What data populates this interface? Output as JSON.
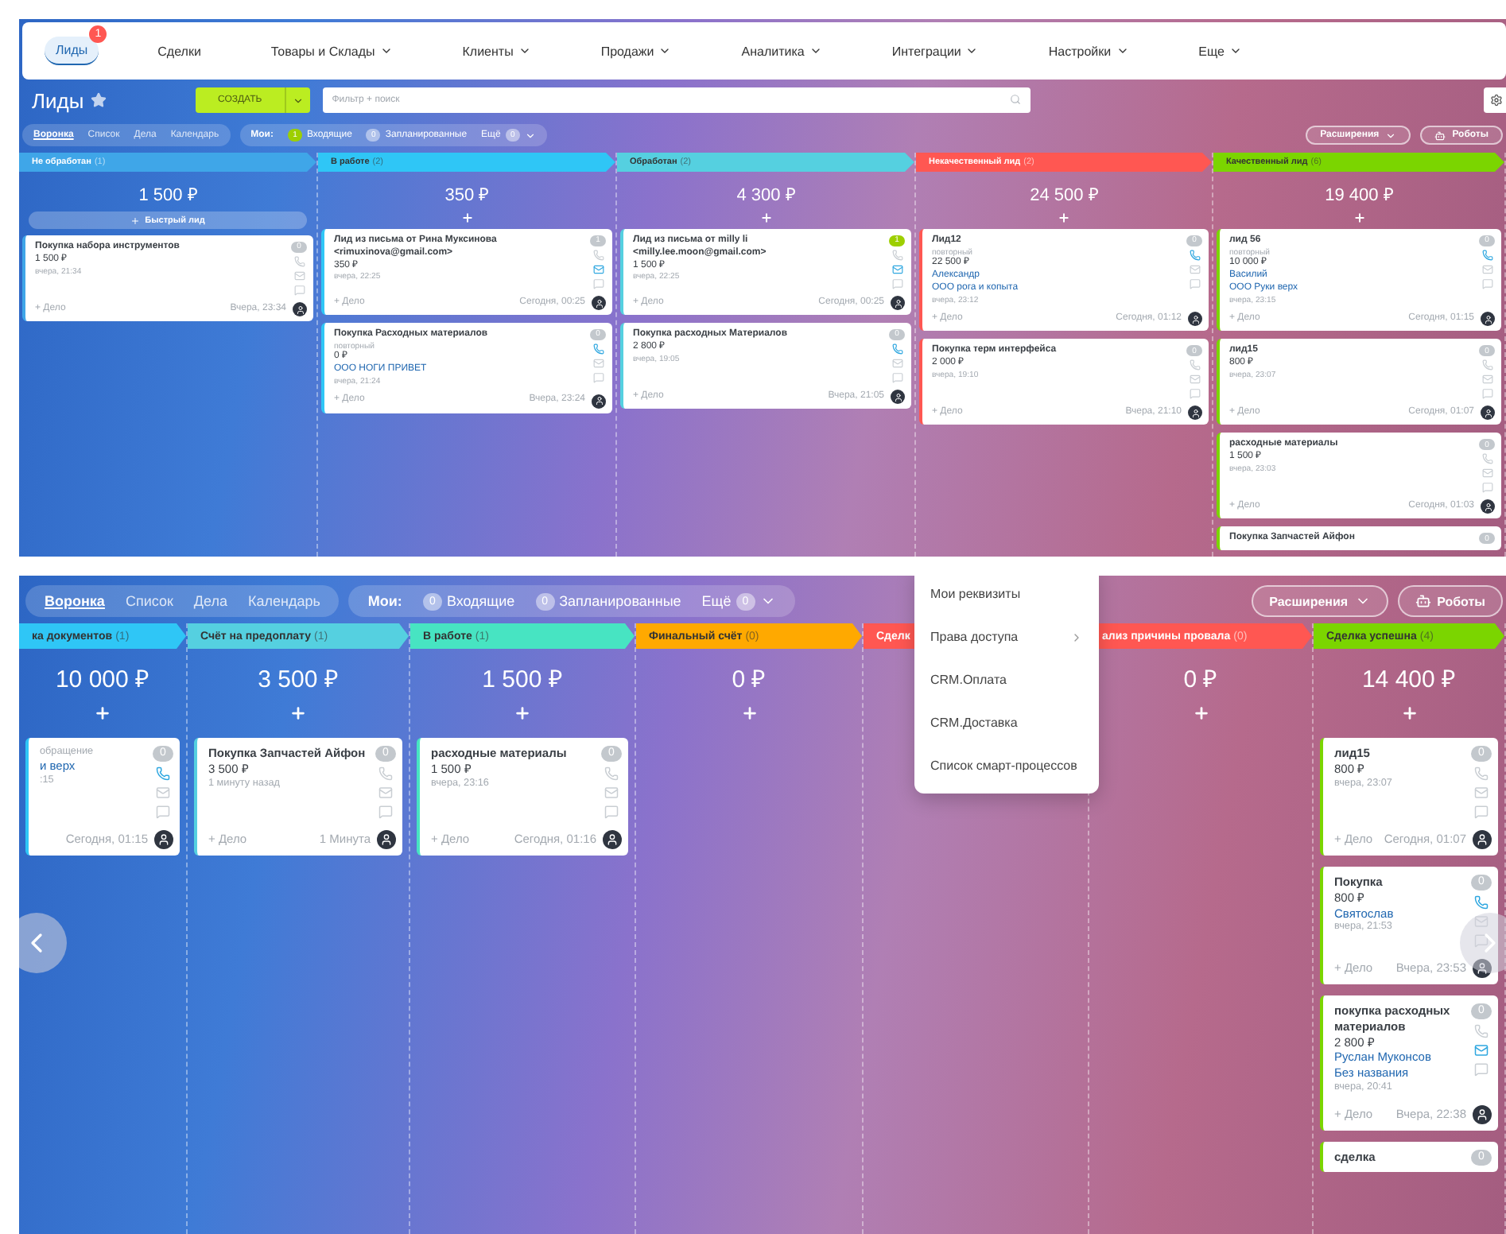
{
  "top": {
    "nav": [
      {
        "label": "Лиды",
        "selected": true,
        "dropdown": false,
        "badge": "1"
      },
      {
        "label": "Сделки",
        "selected": false,
        "dropdown": false
      },
      {
        "label": "Товары и Склады",
        "selected": false,
        "dropdown": true
      },
      {
        "label": "Клиенты",
        "selected": false,
        "dropdown": true
      },
      {
        "label": "Продажи",
        "selected": false,
        "dropdown": true
      },
      {
        "label": "Аналитика",
        "selected": false,
        "dropdown": true
      },
      {
        "label": "Интеграции",
        "selected": false,
        "dropdown": true
      },
      {
        "label": "Настройки",
        "selected": false,
        "dropdown": true
      },
      {
        "label": "Еще",
        "selected": false,
        "dropdown": true
      }
    ],
    "header": {
      "title": "Лиды",
      "create": "СОЗДАТЬ",
      "filter_placeholder": "Фильтр + поиск"
    },
    "toolbar": {
      "views": [
        {
          "label": "Воронка",
          "selected": true
        },
        {
          "label": "Список",
          "selected": false
        },
        {
          "label": "Дела",
          "selected": false
        },
        {
          "label": "Календарь",
          "selected": false
        }
      ],
      "mine_label": "Мои:",
      "counters": [
        {
          "count": "1",
          "label": "Входящие",
          "active": true
        },
        {
          "count": "0",
          "label": "Запланированные",
          "active": false
        }
      ],
      "more": {
        "label": "Ещё",
        "count": "0"
      },
      "extensions": "Расширения",
      "robots": "Роботы"
    },
    "columns": [
      {
        "title": "Не обработан",
        "count": "(1)",
        "color": "#3fa6e8",
        "amount": "1 500 ₽",
        "quick_add": "Быстрый лид",
        "cards": [
          {
            "kind": "full",
            "title": "Покупка набора инструментов",
            "amount": "1 500 ₽",
            "date": "вчера, 21:34",
            "deal": "+ Дело",
            "last": "Вчера, 23:34",
            "counter": "0",
            "counter_active": false,
            "phone_active": false,
            "mail_active": false
          }
        ]
      },
      {
        "title": "В работе",
        "count": "(2)",
        "color": "#2fc6f6",
        "amount": "350 ₽",
        "cards": [
          {
            "kind": "full",
            "title": "Лид из письма от Рина Муксинова <rimuxinova@gmail.com>",
            "amount": "350 ₽",
            "date": "вчера, 22:25",
            "deal": "+ Дело",
            "last": "Сегодня, 00:25",
            "counter": "1",
            "counter_active": false,
            "phone_active": false,
            "mail_active": true
          },
          {
            "kind": "full",
            "title": "Покупка Расходных материалов",
            "repeat": "повторный",
            "amount": "0 ₽",
            "links": [
              "ООО НОГИ ПРИВЕТ"
            ],
            "date": "вчера, 21:24",
            "deal": "+ Дело",
            "last": "Вчера, 23:24",
            "counter": "0",
            "counter_active": false,
            "phone_active": true,
            "mail_active": false
          }
        ]
      },
      {
        "title": "Обработан",
        "count": "(2)",
        "color": "#55d0e0",
        "amount": "4 300 ₽",
        "cards": [
          {
            "kind": "full",
            "title": "Лид из письма от milly li <milly.lee.moon@gmail.com>",
            "amount": "1 500 ₽",
            "date": "вчера, 22:25",
            "deal": "+ Дело",
            "last": "Сегодня, 00:25",
            "counter": "1",
            "counter_active": true,
            "phone_active": false,
            "mail_active": true
          },
          {
            "kind": "full",
            "title": "Покупка расходных Материалов",
            "amount": "2 800 ₽",
            "date": "вчера, 19:05",
            "deal": "+ Дело",
            "last": "Вчера, 21:05",
            "counter": "0",
            "counter_active": false,
            "phone_active": true,
            "mail_active": false
          }
        ]
      },
      {
        "title": "Некачественный лид",
        "count": "(2)",
        "color": "#ff5752",
        "amount": "24 500 ₽",
        "cards": [
          {
            "kind": "full",
            "title": "Лид12",
            "repeat": "повторный",
            "amount": "22 500 ₽",
            "links": [
              "Александр",
              "ООО рога и копыта"
            ],
            "date": "вчера, 23:12",
            "deal": "+ Дело",
            "last": "Сегодня, 01:12",
            "counter": "0",
            "counter_active": false,
            "phone_active": true,
            "mail_active": false
          },
          {
            "kind": "full",
            "title": "Покупка терм интерфейса",
            "amount": "2 000 ₽",
            "date": "вчера, 19:10",
            "deal": "+ Дело",
            "last": "Вчера, 21:10",
            "counter": "0",
            "counter_active": false,
            "phone_active": false,
            "mail_active": false
          }
        ]
      },
      {
        "title": "Качественный лид",
        "count": "(6)",
        "color": "#7bd500",
        "amount": "19 400 ₽",
        "cards": [
          {
            "kind": "full",
            "title": "лид 56",
            "repeat": "повторный",
            "amount": "10 000 ₽",
            "links": [
              "Василий",
              "ООО Руки верх"
            ],
            "date": "вчера, 23:15",
            "deal": "+ Дело",
            "last": "Сегодня, 01:15",
            "counter": "0",
            "counter_active": false,
            "phone_active": true,
            "mail_active": false
          },
          {
            "kind": "full",
            "title": "лид15",
            "amount": "800 ₽",
            "date": "вчера, 23:07",
            "deal": "+ Дело",
            "last": "Сегодня, 01:07",
            "counter": "0",
            "counter_active": false,
            "phone_active": false,
            "mail_active": false
          },
          {
            "kind": "full",
            "title": "расходные материалы",
            "amount": "1 500 ₽",
            "date": "вчера, 23:03",
            "deal": "+ Дело",
            "last": "Сегодня, 01:03",
            "counter": "0",
            "counter_active": false,
            "phone_active": false,
            "mail_active": false
          },
          {
            "kind": "stub",
            "title": "Покупка Запчастей Айфон",
            "counter": "0",
            "counter_active": false
          }
        ]
      }
    ]
  },
  "bottom": {
    "toolbar": {
      "views": [
        {
          "label": "Воронка",
          "selected": true
        },
        {
          "label": "Список",
          "selected": false
        },
        {
          "label": "Дела",
          "selected": false
        },
        {
          "label": "Календарь",
          "selected": false
        }
      ],
      "mine_label": "Мои:",
      "counters": [
        {
          "count": "0",
          "label": "Входящие",
          "active": false
        },
        {
          "count": "0",
          "label": "Запланированные",
          "active": false
        }
      ],
      "more": {
        "label": "Ещё",
        "count": "0"
      },
      "extensions": "Расширения",
      "robots": "Роботы"
    },
    "columns": [
      {
        "title": "ка документов",
        "count": "(1)",
        "color": "#2fc6f6",
        "amount": "10 000 ₽",
        "cards": [
          {
            "kind": "full",
            "repeat": "обращение",
            "links": [
              "и верх"
            ],
            "date": ":15",
            "last": "Сегодня, 01:15",
            "counter": "0",
            "counter_active": false,
            "phone_active": true,
            "mail_active": false
          }
        ]
      },
      {
        "title": "Счёт на предоплату",
        "count": "(1)",
        "color": "#55d0e0",
        "amount": "3 500 ₽",
        "cards": [
          {
            "kind": "full",
            "title": "Покупка Запчастей Айфон",
            "amount": "3 500 ₽",
            "date": "1 минуту назад",
            "deal": "+ Дело",
            "last": "1 Минута",
            "counter": "0",
            "counter_active": false,
            "phone_active": false,
            "mail_active": false
          }
        ]
      },
      {
        "title": "В работе",
        "count": "(1)",
        "color": "#47e4c2",
        "amount": "1 500 ₽",
        "cards": [
          {
            "kind": "full",
            "title": "расходные материалы",
            "amount": "1 500 ₽",
            "date": "вчера, 23:16",
            "deal": "+ Дело",
            "last": "Сегодня, 01:16",
            "counter": "0",
            "counter_active": false,
            "phone_active": false,
            "mail_active": false
          }
        ]
      },
      {
        "title": "Финальный счёт",
        "count": "(0)",
        "color": "#ffa900",
        "amount": "0 ₽"
      },
      {
        "title": "Сделк",
        "color": "#ff5752"
      },
      {
        "title": "ализ причины провала",
        "count": "(0)",
        "color": "#ff5752",
        "amount": "0 ₽"
      },
      {
        "title": "Сделка успешна",
        "count": "(4)",
        "color": "#7bd500",
        "amount": "14 400 ₽",
        "cards": [
          {
            "kind": "full",
            "title": "лид15",
            "amount": "800 ₽",
            "date": "вчера, 23:07",
            "deal": "+ Дело",
            "last": "Сегодня, 01:07",
            "counter": "0",
            "counter_active": false,
            "phone_active": false,
            "mail_active": false
          },
          {
            "kind": "full",
            "title": "Покупка",
            "amount": "800 ₽",
            "links": [
              "Святослав"
            ],
            "date": "вчера, 21:53",
            "deal": "+ Дело",
            "last": "Вчера, 23:53",
            "counter": "0",
            "counter_active": false,
            "phone_active": true,
            "mail_active": false
          },
          {
            "kind": "full",
            "title": "покупка расходных материалов",
            "amount": "2 800 ₽",
            "links": [
              "Руслан Муконсов",
              "Без названия"
            ],
            "date": "вчера, 20:41",
            "deal": "+ Дело",
            "last": "Вчера, 22:38",
            "counter": "0",
            "counter_active": false,
            "phone_active": false,
            "mail_active": true
          },
          {
            "kind": "stub",
            "title": "сделка",
            "counter": "0",
            "counter_active": false
          }
        ]
      }
    ],
    "menu": [
      {
        "label": "Мои реквизиты",
        "has_submenu": false
      },
      {
        "label": "Права доступа",
        "has_submenu": true
      },
      {
        "label": "CRM.Оплата",
        "has_submenu": false
      },
      {
        "label": "CRM.Доставка",
        "has_submenu": false
      },
      {
        "label": "Список смарт-процессов",
        "has_submenu": false
      }
    ]
  }
}
